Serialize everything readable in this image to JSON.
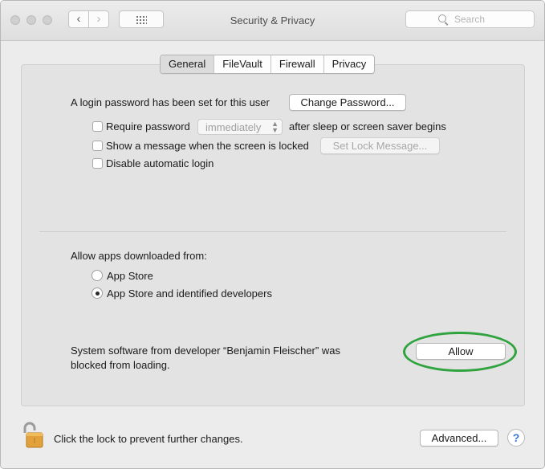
{
  "window": {
    "title": "Security & Privacy",
    "search_placeholder": "Search",
    "back_glyph": "‹",
    "forward_glyph": "›"
  },
  "tabs": [
    {
      "label": "General",
      "selected": true
    },
    {
      "label": "FileVault",
      "selected": false
    },
    {
      "label": "Firewall",
      "selected": false
    },
    {
      "label": "Privacy",
      "selected": false
    }
  ],
  "general": {
    "login_password_text": "A login password has been set for this user",
    "change_password_button": "Change Password...",
    "require_password": {
      "label": "Require password",
      "checked": false,
      "enabled": true
    },
    "require_password_delay": {
      "value": "immediately",
      "enabled": false
    },
    "after_sleep_text": "after sleep or screen saver begins",
    "show_message": {
      "label": "Show a message when the screen is locked",
      "checked": false
    },
    "set_lock_message_button": "Set Lock Message...",
    "disable_auto_login": {
      "label": "Disable automatic login",
      "checked": false
    }
  },
  "allow_apps": {
    "heading": "Allow apps downloaded from:",
    "options": [
      {
        "label": "App Store",
        "selected": false
      },
      {
        "label": "App Store and identified developers",
        "selected": true
      }
    ]
  },
  "blocked": {
    "line1": "System software from developer “Benjamin Fleischer” was",
    "line2": "blocked from loading.",
    "allow_button": "Allow",
    "highlight_color": "#2fa33d"
  },
  "footer": {
    "lock_text": "Click the lock to prevent further changes.",
    "advanced_button": "Advanced...",
    "help_label": "?"
  },
  "icons": {
    "lock": "padlock-open-icon",
    "help": "help-icon",
    "search": "search-icon"
  }
}
